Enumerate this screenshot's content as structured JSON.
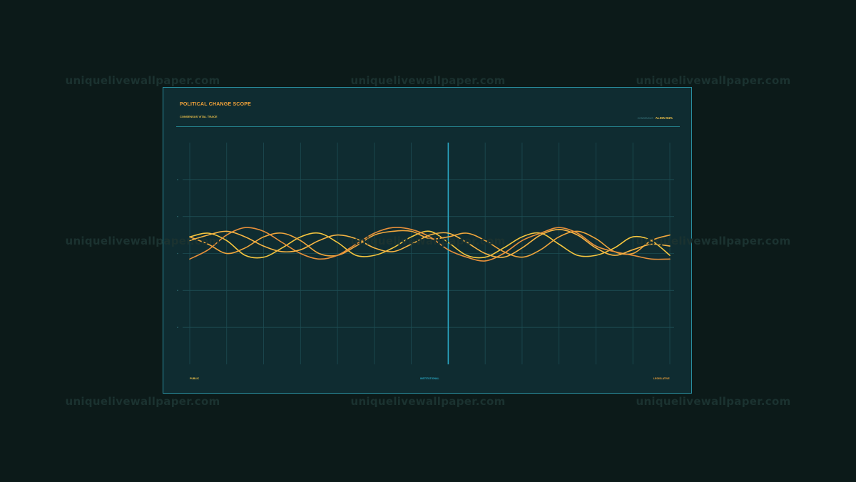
{
  "watermark": "uniquelivewallpaper.com",
  "panel": {
    "title": "POLITICAL CHANGE SCOPE",
    "subtitle": "CONSENSUS VITAL TRACE",
    "readout_label": "CONSENSUS",
    "readout_value": "ALIGN 94%"
  },
  "colors": {
    "background": "#0c1a19",
    "panel": "#0f2c31",
    "border": "#2a8fa0",
    "grid": "#1d4c53",
    "cursor": "#2aa8c4",
    "accent_orange": "#f2a33a",
    "accent_yellow": "#f0c34a"
  },
  "chart_data": {
    "type": "line",
    "grid": true,
    "cursor_x": 7,
    "xlim": [
      0,
      13
    ],
    "ylim": [
      -3,
      3
    ],
    "x": [
      0,
      0.5,
      1,
      1.5,
      2,
      2.5,
      3,
      3.5,
      4,
      4.5,
      5,
      5.5,
      6,
      6.5,
      7,
      7.5,
      8,
      8.5,
      9,
      9.5,
      10,
      10.5,
      11,
      11.5,
      12,
      12.5,
      13
    ],
    "categories": [
      {
        "label": "PUBLIC",
        "x": 0,
        "color": "#f0c34a"
      },
      {
        "label": "INSTITUTIONAL",
        "x": 6.5,
        "color": "#2aa8c4"
      },
      {
        "label": "LEGISLATIVE",
        "x": 13,
        "color": "#f2a33a"
      }
    ],
    "series": [
      {
        "color": "#f5c63f",
        "values": [
          0.45,
          0.55,
          0.35,
          -0.05,
          -0.1,
          0.15,
          0.45,
          0.55,
          0.3,
          -0.05,
          -0.05,
          0.15,
          0.45,
          0.6,
          0.3,
          -0.05,
          -0.1,
          0.15,
          0.45,
          0.55,
          0.25,
          -0.05,
          -0.05,
          0.15,
          0.45,
          0.35,
          -0.05
        ]
      },
      {
        "color": "#f0a63c",
        "values": [
          0.45,
          0.25,
          0.0,
          0.15,
          0.45,
          0.55,
          0.35,
          0.0,
          -0.05,
          0.2,
          0.5,
          0.6,
          0.6,
          0.4,
          0.45,
          0.55,
          0.35,
          0.05,
          -0.1,
          0.1,
          0.45,
          0.6,
          0.4,
          0.05,
          0.0,
          0.35,
          0.5
        ]
      },
      {
        "color": "#e8903a",
        "values": [
          -0.15,
          0.1,
          0.5,
          0.7,
          0.6,
          0.3,
          0.0,
          -0.15,
          -0.05,
          0.25,
          0.55,
          0.7,
          0.65,
          0.45,
          0.1,
          -0.1,
          -0.2,
          0.0,
          0.35,
          0.55,
          0.7,
          0.55,
          0.2,
          0.05,
          -0.05,
          -0.15,
          -0.15
        ]
      },
      {
        "color": "#f7b544",
        "values": [
          0.35,
          0.5,
          0.6,
          0.45,
          0.2,
          0.05,
          0.1,
          0.35,
          0.5,
          0.4,
          0.15,
          0.05,
          0.25,
          0.5,
          0.55,
          0.3,
          0.0,
          -0.1,
          0.15,
          0.5,
          0.65,
          0.5,
          0.15,
          -0.05,
          0.1,
          0.25,
          0.2
        ]
      }
    ]
  }
}
